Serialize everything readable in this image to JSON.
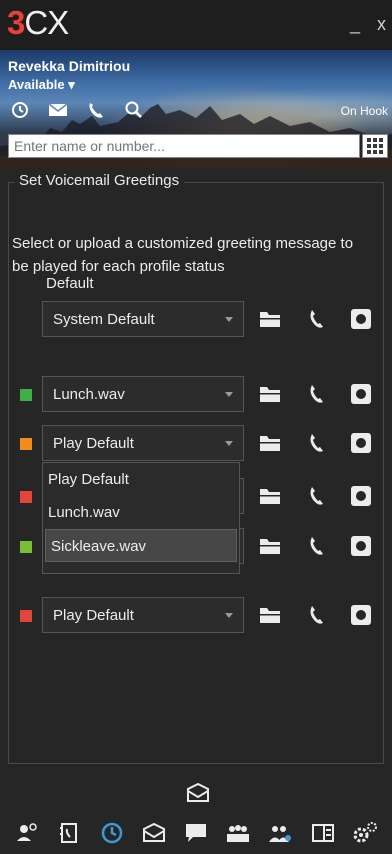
{
  "app": {
    "logo_number": "3",
    "logo_text": "CX",
    "minimize": "_",
    "close": "x"
  },
  "user": {
    "name": "Revekka Dimitriou",
    "status": "Available ▾",
    "hook": "On Hook"
  },
  "search": {
    "placeholder": "Enter name or number..."
  },
  "voicemail": {
    "group_title": "Set Voicemail Greetings",
    "description": "Select or upload a customized greeting message to be played for each profile status",
    "default_label": "Default",
    "rows": [
      {
        "status_color": "",
        "value": "System Default"
      },
      {
        "status_color": "#3cb043",
        "value": "Lunch.wav"
      },
      {
        "status_color": "#f28c1c",
        "value": "Play Default"
      },
      {
        "status_color": "#e2453a",
        "value": ""
      },
      {
        "status_color": "#78c031",
        "value": ""
      },
      {
        "status_color": "#e2453a",
        "value": "Play Default"
      }
    ],
    "dropdown_options": [
      "Play Default",
      "Lunch.wav",
      "Sickleave.wav"
    ],
    "dropdown_selected": "Sickleave.wav"
  },
  "icons": {
    "header": [
      "history-icon",
      "mail-icon",
      "phone-icon",
      "search-icon"
    ],
    "taskbar": [
      "contacts-icon",
      "phonebook-icon",
      "history-icon",
      "voicemail-icon",
      "chat-icon",
      "presence-icon",
      "conference-icon",
      "switchboard-icon",
      "settings-icon"
    ]
  },
  "colors": {
    "accent": "#3a9bdc",
    "brand": "#e8413a",
    "background": "#262626"
  }
}
